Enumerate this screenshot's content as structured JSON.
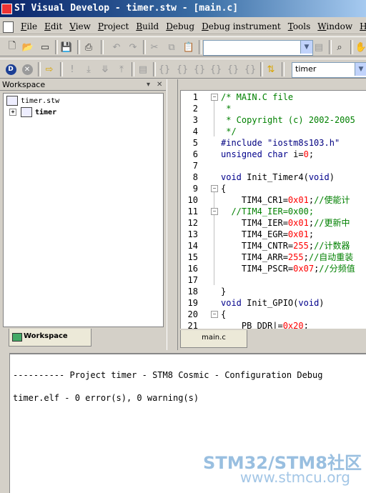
{
  "window": {
    "title": "ST Visual Develop - timer.stw - [main.c]"
  },
  "menu": [
    "File",
    "Edit",
    "View",
    "Project",
    "Build",
    "Debug",
    "Debug instrument",
    "Tools",
    "Window",
    "Help"
  ],
  "toolbar": {
    "config_combo": "",
    "target_combo": "timer"
  },
  "workspace": {
    "title": "Workspace",
    "tree": {
      "root": "timer.stw",
      "project": "timer"
    },
    "tab": "Workspace"
  },
  "editor": {
    "tab": "main.c",
    "line_numbers": [
      "1",
      "2",
      "3",
      "4",
      "5",
      "6",
      "7",
      "8",
      "9",
      "10",
      "11",
      "12",
      "13",
      "14",
      "15",
      "16",
      "17",
      "18",
      "19",
      "20",
      "21"
    ],
    "lines": [
      [
        {
          "t": "/* MAIN.C file",
          "c": "comment"
        }
      ],
      [
        {
          "t": " *",
          "c": "comment"
        }
      ],
      [
        {
          "t": " * Copyright (c) 2002-2005",
          "c": "comment"
        }
      ],
      [
        {
          "t": " */",
          "c": "comment"
        }
      ],
      [
        {
          "t": "#include ",
          "c": "pp"
        },
        {
          "t": "\"iostm8s103.h\"",
          "c": "str"
        }
      ],
      [
        {
          "t": "unsigned char",
          "c": "kw"
        },
        {
          "t": " i=",
          "c": "plain"
        },
        {
          "t": "0",
          "c": "num"
        },
        {
          "t": ";",
          "c": "plain"
        }
      ],
      [],
      [
        {
          "t": "void",
          "c": "kw"
        },
        {
          "t": " Init_Timer4(",
          "c": "plain"
        },
        {
          "t": "void",
          "c": "kw"
        },
        {
          "t": ")",
          "c": "plain"
        }
      ],
      [
        {
          "t": "{",
          "c": "plain"
        }
      ],
      [
        {
          "t": "    TIM4_CR1=",
          "c": "plain"
        },
        {
          "t": "0x01",
          "c": "num"
        },
        {
          "t": ";",
          "c": "plain"
        },
        {
          "t": "//使能计",
          "c": "comment"
        }
      ],
      [
        {
          "t": "  //TIM4_IER=0x00;",
          "c": "comment"
        }
      ],
      [
        {
          "t": "    TIM4_IER=",
          "c": "plain"
        },
        {
          "t": "0x01",
          "c": "num"
        },
        {
          "t": ";",
          "c": "plain"
        },
        {
          "t": "//更新中",
          "c": "comment"
        }
      ],
      [
        {
          "t": "    TIM4_EGR=",
          "c": "plain"
        },
        {
          "t": "0x01",
          "c": "num"
        },
        {
          "t": ";",
          "c": "plain"
        }
      ],
      [
        {
          "t": "    TIM4_CNTR=",
          "c": "plain"
        },
        {
          "t": "255",
          "c": "num"
        },
        {
          "t": ";",
          "c": "plain"
        },
        {
          "t": "//计数器",
          "c": "comment"
        }
      ],
      [
        {
          "t": "    TIM4_ARR=",
          "c": "plain"
        },
        {
          "t": "255",
          "c": "num"
        },
        {
          "t": ";",
          "c": "plain"
        },
        {
          "t": "//自动重装",
          "c": "comment"
        }
      ],
      [
        {
          "t": "    TIM4_PSCR=",
          "c": "plain"
        },
        {
          "t": "0x07",
          "c": "num"
        },
        {
          "t": ";",
          "c": "plain"
        },
        {
          "t": "//分频值",
          "c": "comment"
        }
      ],
      [],
      [
        {
          "t": "}",
          "c": "plain"
        }
      ],
      [
        {
          "t": "void",
          "c": "kw"
        },
        {
          "t": " Init_GPIO(",
          "c": "plain"
        },
        {
          "t": "void",
          "c": "kw"
        },
        {
          "t": ")",
          "c": "plain"
        }
      ],
      [
        {
          "t": "{",
          "c": "plain"
        }
      ],
      [
        {
          "t": "    PB_DDR|=",
          "c": "plain"
        },
        {
          "t": "0x20",
          "c": "num"
        },
        {
          "t": ";",
          "c": "plain"
        }
      ]
    ]
  },
  "output": {
    "lines": [
      "---------- Project timer - STM8 Cosmic - Configuration Debug",
      "",
      "timer.elf - 0 error(s), 0 warning(s)"
    ]
  },
  "watermark": {
    "line1": "STM32/STM8社区",
    "line2": "www.stmcu.org"
  },
  "colors": {
    "comment": "#008000",
    "keyword": "#00008b",
    "number": "#ff0000",
    "title_start": "#0a246a",
    "title_end": "#a6caf0"
  }
}
